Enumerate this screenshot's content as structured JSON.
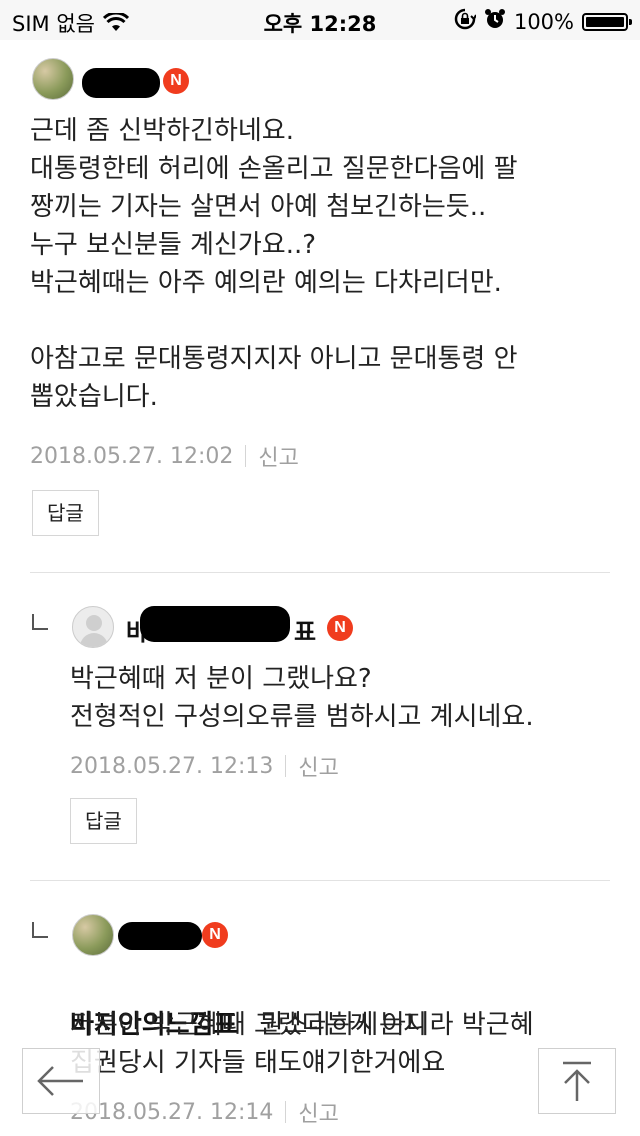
{
  "status_bar": {
    "carrier": "SIM 없음",
    "time": "오후 12:28",
    "battery": "100%",
    "battery_level": 1.0,
    "icons": [
      "wifi-icon",
      "rotation-lock-icon",
      "alarm-icon",
      "battery-icon"
    ]
  },
  "comments": [
    {
      "level": 0,
      "avatar": "photo",
      "badge": "N",
      "lines": "근데 좀 신박하긴하네요.\n대통령한테 허리에 손올리고 질문한다음에 팔\n짱끼는 기자는 살면서 아예 첨보긴하는듯..\n누구 보신분들 계신가요..?\n박근혜때는 아주 예의란 예의는 다차리더만.\n\n아참고로 문대통령지지자 아니고 문대통령 안\n뽑았습니다.",
      "date": "2018.05.27. 12:02",
      "report": "신고",
      "reply": "답글"
    },
    {
      "level": 1,
      "avatar": "default",
      "author_visible": "바",
      "author_tail": "표",
      "badge": "N",
      "lines": "박근혜때 저 분이 그랬나요?\n전형적인 구성의오류를 범하시고 계시네요.",
      "date": "2018.05.27. 12:13",
      "report": "신고",
      "reply": "답글"
    },
    {
      "level": 1,
      "avatar": "photo",
      "badge": "N",
      "mention": "바지안의느낌표",
      "first_line": "뭔소리하시는지",
      "lines": "저분이 박근혜때 그랬다는게 아니라 박근혜\n집권당시 기자들 태도얘기한거에요",
      "date": "2018.05.27. 12:14",
      "report": "신고"
    }
  ],
  "nav": {
    "back_icon": "back-arrow-icon",
    "top_icon": "scroll-top-icon"
  },
  "colors": {
    "badge": "#f03c1e",
    "meta": "#a0a0a0",
    "divider": "#e2e2e2"
  }
}
